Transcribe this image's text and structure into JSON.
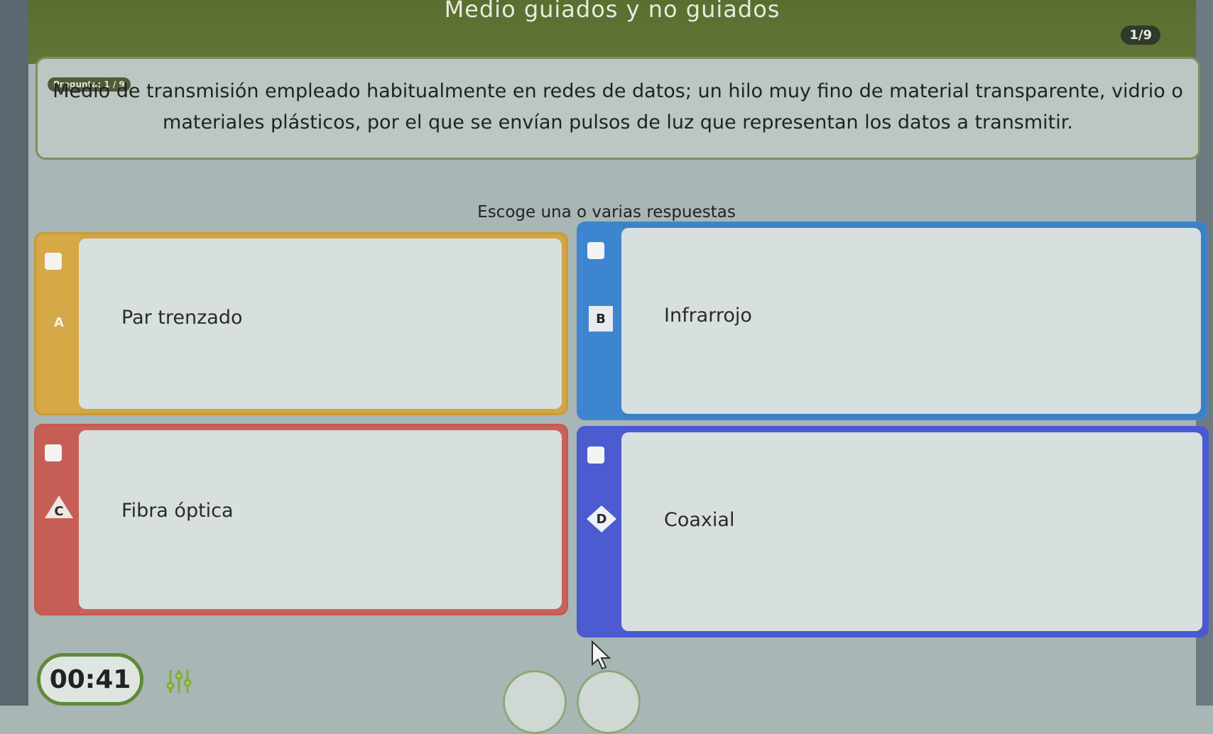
{
  "header": {
    "title": "Medio guiados y no guiados",
    "counter": "1/9"
  },
  "question": {
    "badge": "Pregunta: 1 / 9",
    "text": "Medio de transmisión empleado habitualmente en redes de datos; un hilo muy fino de material transparente, vidrio o materiales plásticos, por el que se envían pulsos de luz que representan los datos a transmitir."
  },
  "instruction": "Escoge una o varias respuestas",
  "options": [
    {
      "letter": "A",
      "label": "Par trenzado",
      "shape": "circle",
      "color": "#d2a645"
    },
    {
      "letter": "B",
      "label": "Infrarrojo",
      "shape": "square",
      "color": "#3b7fc7"
    },
    {
      "letter": "C",
      "label": "Fibra óptica",
      "shape": "triangle",
      "color": "#c96358"
    },
    {
      "letter": "D",
      "label": "Coaxial",
      "shape": "diamond",
      "color": "#4b5ad0"
    }
  ],
  "footer": {
    "timer": "00:41",
    "sound_icon": "equalizer-icon"
  }
}
